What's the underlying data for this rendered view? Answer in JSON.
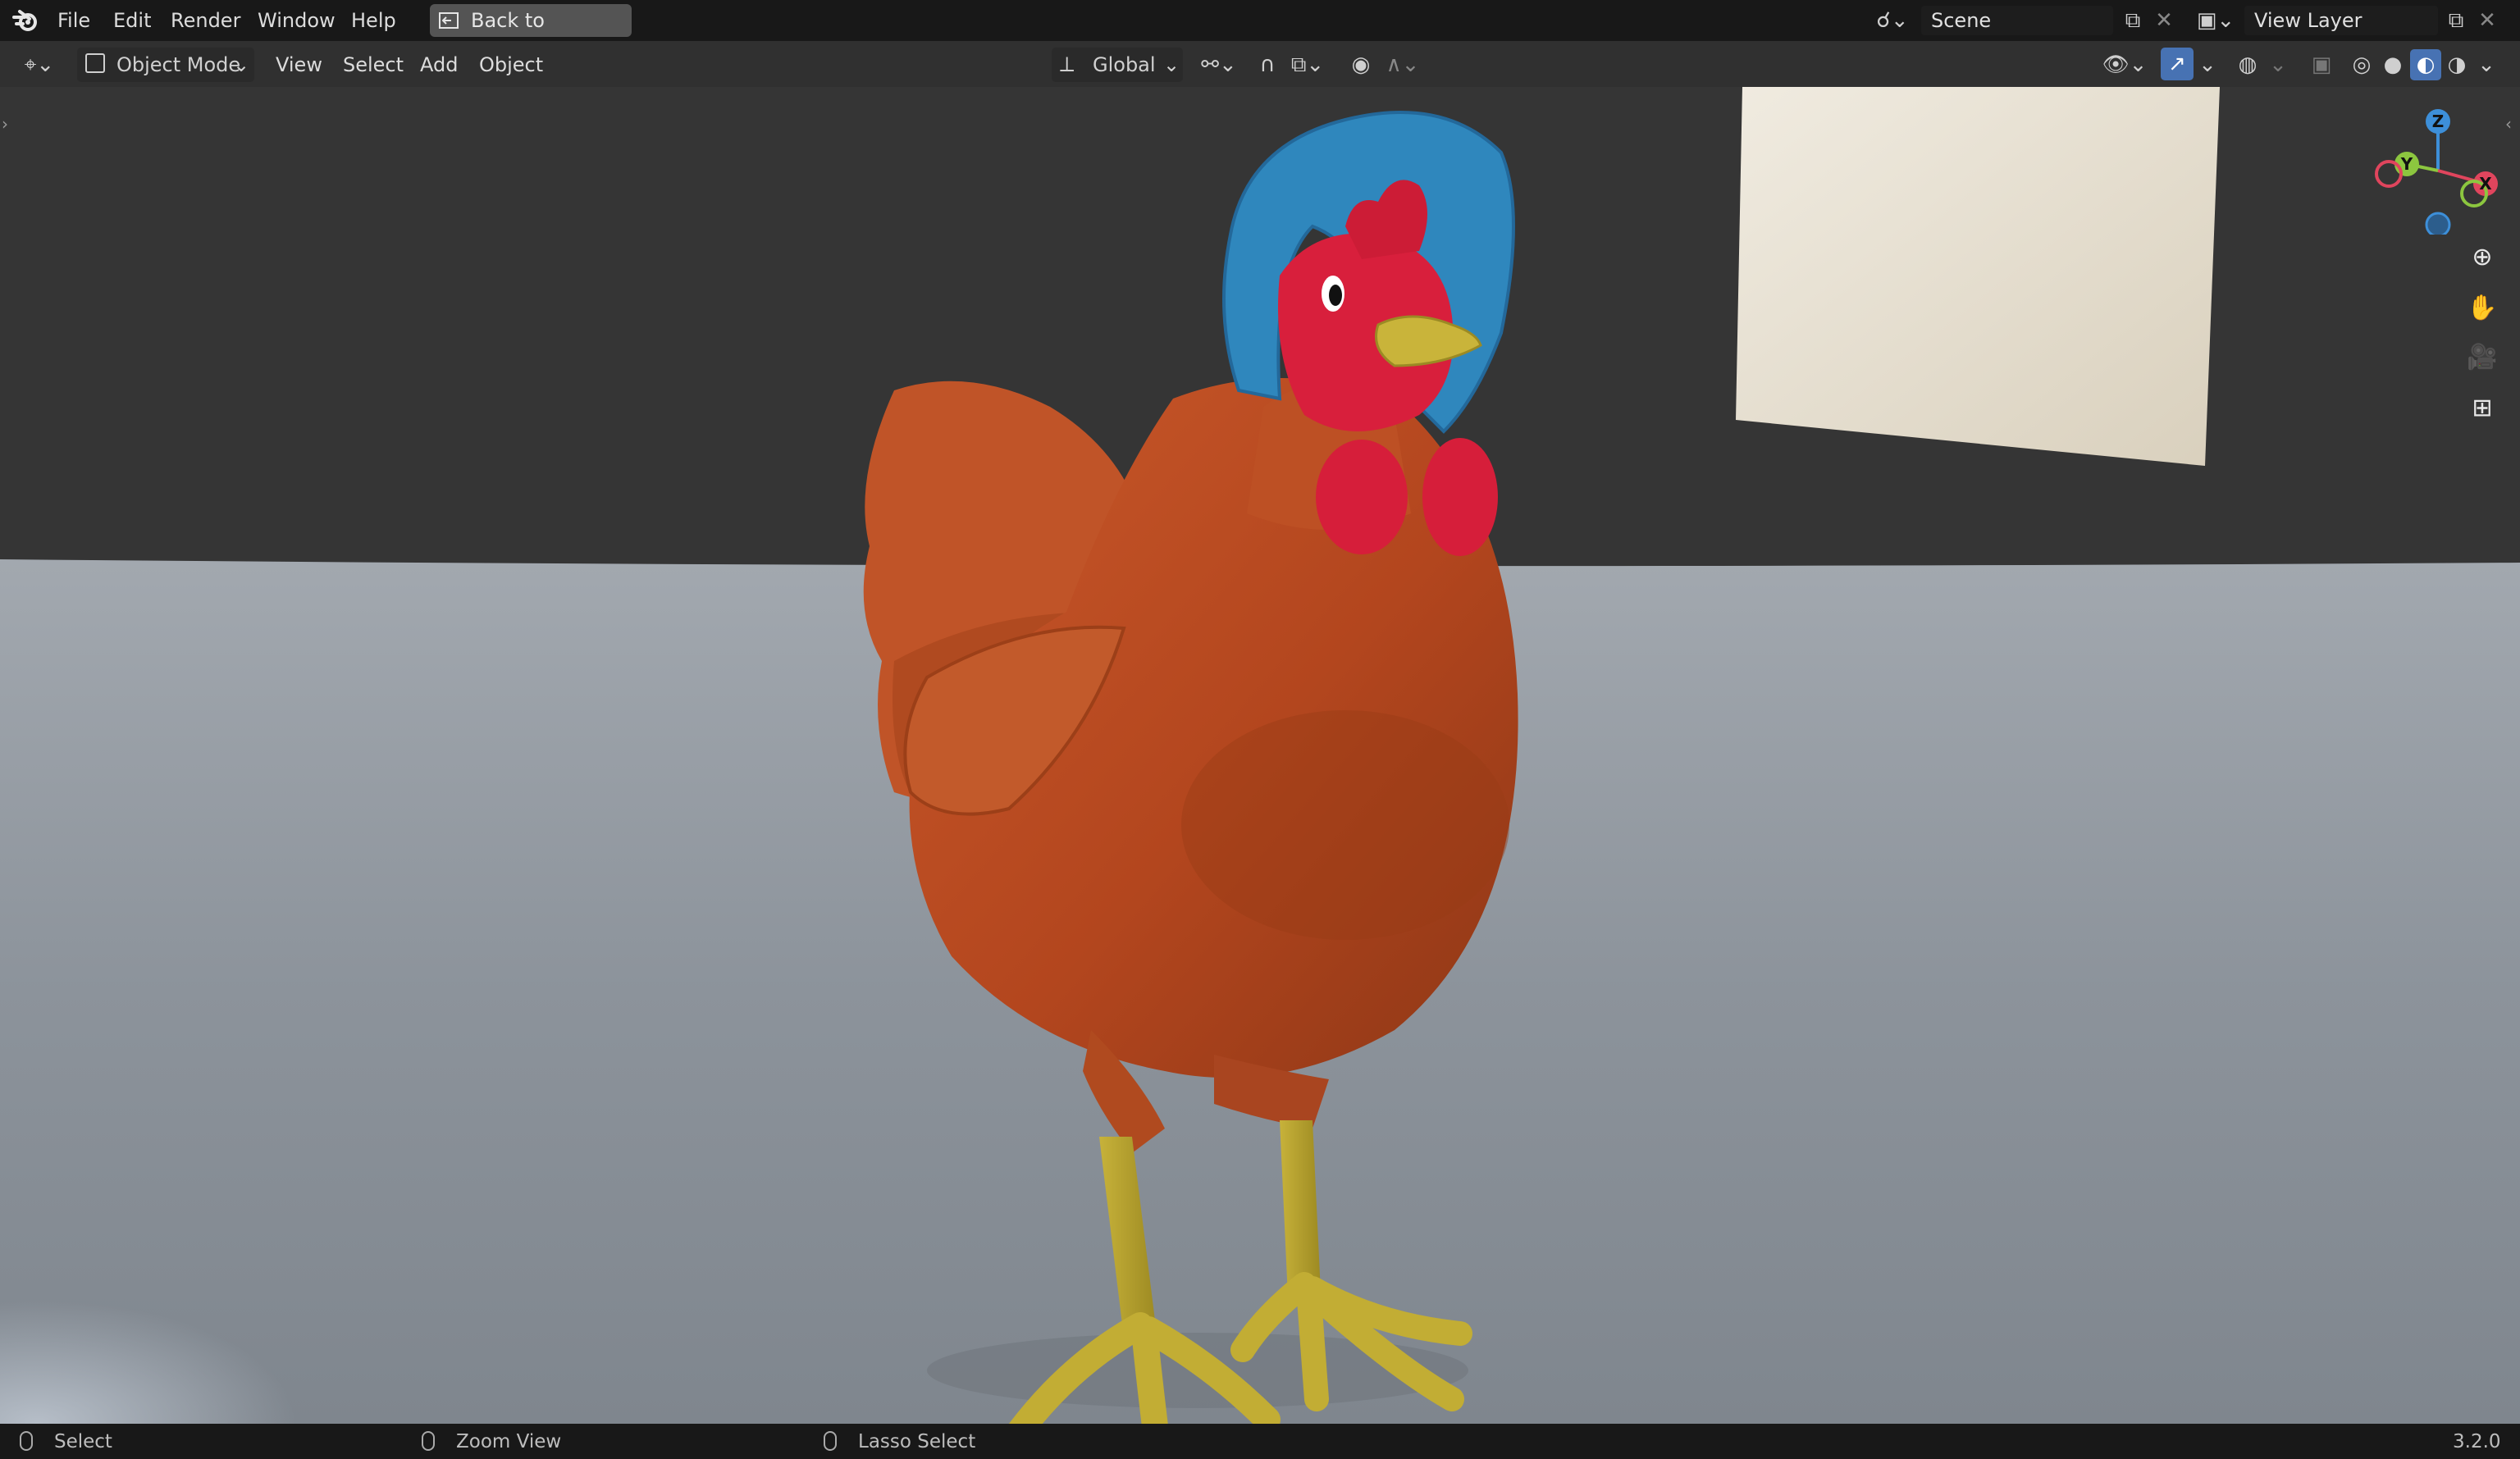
{
  "menubar": {
    "items": [
      "File",
      "Edit",
      "Render",
      "Window",
      "Help"
    ],
    "back_button": "Back to Previous",
    "scene_label": "Scene",
    "view_layer_label": "View Layer"
  },
  "header": {
    "mode": "Object Mode",
    "menus": [
      "View",
      "Select",
      "Add",
      "Object"
    ],
    "orientation": "Global"
  },
  "gizmo": {
    "x": "X",
    "y": "Y",
    "z": "Z",
    "colors": {
      "x": "#e0455d",
      "y": "#8cc63f",
      "z": "#3d8fd9"
    }
  },
  "statusbar": {
    "left_action": "Select",
    "middle_action": "Zoom View",
    "right_action": "Lasso Select",
    "version": "3.2.0"
  },
  "colors": {
    "accent_blue": "#4772b3",
    "chicken_body": "#b8481f",
    "bonnet": "#2f87bd",
    "comb": "#d61e3a",
    "beak": "#c9b43a",
    "floor": "#8a9098"
  }
}
